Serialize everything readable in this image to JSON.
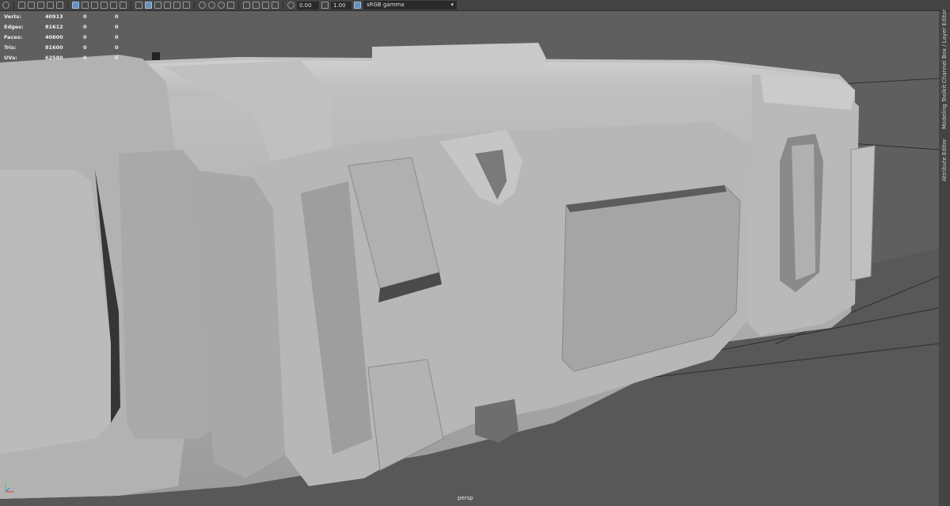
{
  "toolbar": {
    "exposure_value": "0.00",
    "gamma_value": "1.00",
    "color_space": "sRGB gamma",
    "icons": [
      "camera-select-icon",
      "camera-attributes-icon",
      "bookmarks-icon",
      "image-plane-icon",
      "grid-toggle-icon",
      "film-gate-icon",
      "resolution-gate-icon",
      "gate-mask-icon",
      "field-chart-icon",
      "safe-action-icon",
      "wireframe-icon",
      "smooth-shade-icon",
      "default-material-icon",
      "textured-icon",
      "use-lights-icon",
      "shadows-icon",
      "isolate-select-icon",
      "xray-icon",
      "exposure-icon",
      "gamma-icon",
      "color-manage-icon"
    ]
  },
  "hud": {
    "rows": [
      {
        "label": "Verts:",
        "value": "40913",
        "sel": "0",
        "comp": "0"
      },
      {
        "label": "Edges:",
        "value": "81612",
        "sel": "0",
        "comp": "0"
      },
      {
        "label": "Faces:",
        "value": "40800",
        "sel": "0",
        "comp": "0"
      },
      {
        "label": "Tris:",
        "value": "81600",
        "sel": "0",
        "comp": "0"
      },
      {
        "label": "UVs:",
        "value": "62580",
        "sel": "0",
        "comp": "0"
      }
    ]
  },
  "panels": {
    "channel_box": "Channel Box / Layer Editor",
    "modeling_toolkit": "Modeling Toolkit",
    "attribute_editor": "Attribute Editor"
  },
  "viewport": {
    "camera": "persp"
  },
  "colors": {
    "background": "#5d5d5d",
    "model_light": "#b9b9b9",
    "model_mid": "#a2a2a2",
    "model_dark": "#7b7b7b",
    "grid": "#2f2f2f"
  }
}
